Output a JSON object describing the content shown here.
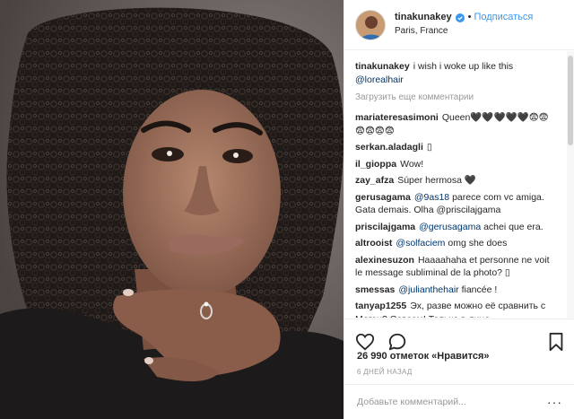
{
  "header": {
    "username": "tinakunakey",
    "dot": "•",
    "follow_label": "Подписаться",
    "location": "Paris, France"
  },
  "caption": {
    "username": "tinakunakey",
    "text": "i wish i woke up like this",
    "mention": "@lorealhair"
  },
  "load_more": "Загрузить еще комментарии",
  "comments": [
    {
      "user": "mariateresasimoni",
      "mention": "",
      "text": "Queen🖤🖤🖤🖤🖤😨😨😨😨😨😨"
    },
    {
      "user": "serkan.aladagli",
      "mention": "",
      "text": "▯"
    },
    {
      "user": "il_gioppa",
      "mention": "",
      "text": "Wow!"
    },
    {
      "user": "zay_afza",
      "mention": "",
      "text": "Súper hermosa 🖤"
    },
    {
      "user": "gerusagama",
      "mention": "@9as18",
      "text": "parece com vc amiga. Gata demais. Olha @priscilajgama"
    },
    {
      "user": "priscilajgama",
      "mention": "@gerusagama",
      "text": "achei que era."
    },
    {
      "user": "altrooist",
      "mention": "@solfaciem",
      "text": "omg she does"
    },
    {
      "user": "alexinesuzon",
      "mention": "",
      "text": "Haaaahaha et personne ne voit le message subliminal de la photo? ▯"
    },
    {
      "user": "smessas",
      "mention": "@julianthehair",
      "text": "fiancée !"
    },
    {
      "user": "tanyap1255",
      "mention": "",
      "text": "Эх, разве можно её сравнить с Меган? Совсем! Только в лице"
    }
  ],
  "actions": {
    "like_icon": "heart-icon",
    "comment_icon": "comment-icon",
    "save_icon": "bookmark-icon"
  },
  "likes": "26 990 отметок «Нравится»",
  "time_ago": "6 ДНЕЙ НАЗАД",
  "add_comment": {
    "placeholder": "Добавьте комментарий...",
    "more_label": "···"
  },
  "colors": {
    "link": "#3897f0",
    "mention": "#003569",
    "muted": "#999999",
    "border": "#efefef"
  }
}
